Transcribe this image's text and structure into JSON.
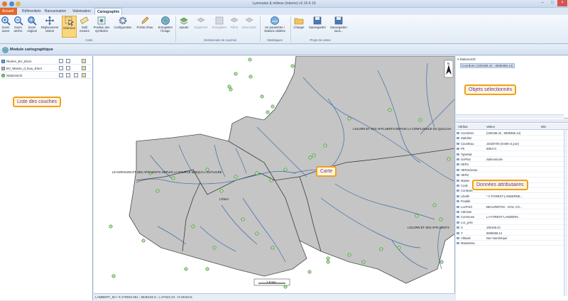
{
  "window": {
    "title": "Lyonnaise & milieux (interne) v2.10.4.19"
  },
  "tabs": [
    "Accueil",
    "Référentiels",
    "Bancarisation",
    "Valorisation",
    "Cartographie"
  ],
  "ribbon": {
    "buttons": [
      {
        "label": "Zoom avant"
      },
      {
        "label": "Zoom arrière"
      },
      {
        "label": "Zoom original"
      },
      {
        "label": "Déplacement latéral"
      },
      {
        "label": "Sélection"
      },
      {
        "label": "Outil mesure"
      },
      {
        "label": "Position des symboles"
      },
      {
        "label": "Configuration"
      },
      {
        "label": "Points d'eau"
      },
      {
        "label": "Enregistrer l'image"
      },
      {
        "label": "Ajouter"
      },
      {
        "label": "Supprimer"
      },
      {
        "label": "Enregistrer"
      },
      {
        "label": "Filtrer"
      },
      {
        "label": "Déscendre"
      },
      {
        "label": "Un paramètre / stations visitées"
      },
      {
        "label": "Charger"
      },
      {
        "label": "Sauvegarder"
      },
      {
        "label": "Sauvegarder sous..."
      }
    ],
    "groups": [
      "Carte",
      "Gestionnaire de couches",
      "Statistiques",
      "Projet de cartes"
    ]
  },
  "module": {
    "title": "Module cartographique"
  },
  "layers": [
    "Rivière_BV_Elorn",
    "BV_Masse_d_Eau_Elorn",
    "StationsCE"
  ],
  "callouts": {
    "layers": "Liste des couches",
    "map": "Carte",
    "selected": "Objets sélectionnés",
    "attributes": "Données attributaires"
  },
  "map": {
    "labels": [
      "L'ELORN ET SES AFFLUENTS DEPUIS LA CONFLUENCE DU QUILLIVA",
      "LE KERHUON ET SES AFFLUENTS DEPUIS LA SOURCE JUSQU'A L'ESTUAIRE",
      "L'Elorn",
      "L'ELORN ET SES AFFLUENTS"
    ],
    "scale": "1.6 km",
    "north": "N",
    "status": "LAMBERT_93  •  X:175940.061 ; 6845192.5 ; L:27622.23 ; H:18163.5"
  },
  "selection": {
    "layer": "StationsCE",
    "item": "Coordonn (150158.42 ; 6838456.14)"
  },
  "attributes": {
    "headers": [
      "Attribut",
      "Valeur",
      "Min"
    ],
    "rows": [
      {
        "a": "Coordonn",
        "v": "(150158.42 ; 6838456.14)"
      },
      {
        "a": "Stahéler",
        "v": ""
      },
      {
        "a": "CoursEau",
        "v": "J3426700 (mettre à jour)"
      },
      {
        "a": "PK",
        "v": "595174"
      },
      {
        "a": "TypeNat",
        "v": ""
      },
      {
        "a": "GvPisci",
        "v": "Salmonicole"
      },
      {
        "a": "HER1",
        "v": ""
      },
      {
        "a": "HER1niveau",
        "v": ""
      },
      {
        "a": "HER2",
        "v": ""
      },
      {
        "a": "Masse",
        "v": ""
      },
      {
        "a": "Code",
        "v": ""
      },
      {
        "a": "Contexte",
        "v": ""
      },
      {
        "a": "Libellé",
        "v": "* À FOREST-LANDERNE..."
      },
      {
        "a": "Finalité",
        "v": ""
      },
      {
        "a": "LocPrécl",
        "v": "BEAUREPOS - AVAL CO..."
      },
      {
        "a": "Adresse",
        "v": ""
      },
      {
        "a": "Commune",
        "v": "LA FOREST-LANDERN..."
      },
      {
        "a": "Loc_préc",
        "v": ""
      },
      {
        "a": "X",
        "v": "150158.42"
      },
      {
        "a": "Y",
        "v": "6838456.14"
      },
      {
        "a": "Altitude",
        "v": "Non Numérique"
      },
      {
        "a": "MasseEau",
        "v": ""
      }
    ]
  }
}
